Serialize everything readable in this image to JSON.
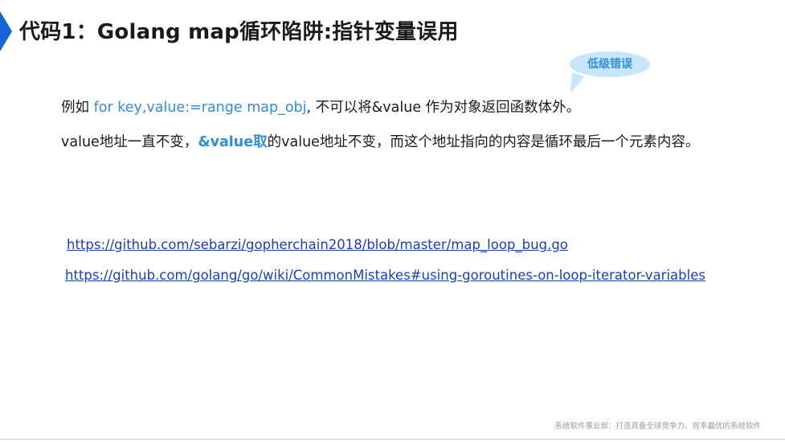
{
  "title": "代码1：Golang map循环陷阱:指针变量误用",
  "bubble": {
    "label": "低级错误"
  },
  "paragraph1": {
    "prefix": "例如 ",
    "code": "for key,value:=range map_obj",
    "suffix": ", 不可以将&value 作为对象返回函数体外。"
  },
  "paragraph2": {
    "prefix": "value地址一直不变，",
    "emphasis": "&value取",
    "suffix": "的value地址不变，而这个地址指向的内容是循环最后一个元素内容。"
  },
  "links": [
    "https://github.com/sebarzi/gopherchain2018/blob/master/map_loop_bug.go",
    "https://github.com/golang/go/wiki/CommonMistakes#using-goroutines-on-loop-iterator-variables"
  ],
  "footer": "系统软件事业部：打造具备全球竞争力、效率最优的系统软件",
  "colors": {
    "accent": "#1565d8",
    "highlight": "#2e8fd6",
    "bubble_bg": "#c7e6fb",
    "link": "#1a3fb0"
  }
}
